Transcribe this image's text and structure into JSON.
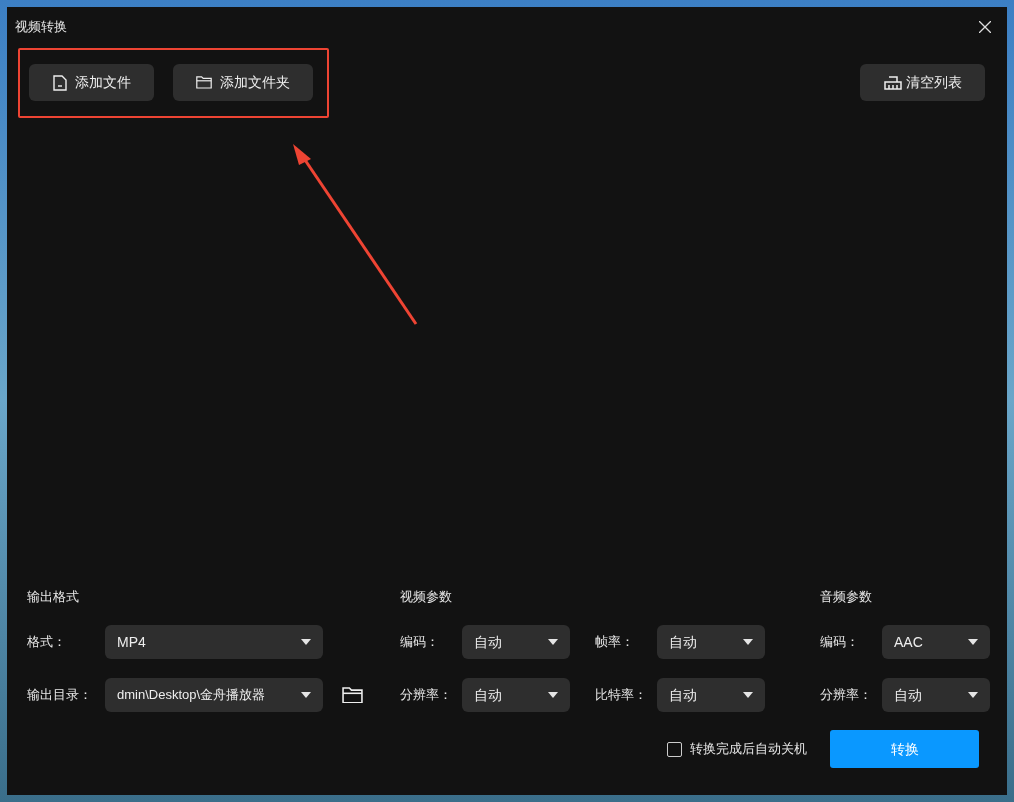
{
  "window": {
    "title": "视频转换"
  },
  "toolbar": {
    "buttons": [
      {
        "kind": "file",
        "label": "添加文件"
      },
      {
        "kind": "folder",
        "label": "添加文件夹"
      }
    ],
    "clear_button": "清空列表"
  },
  "output_format": {
    "heading": "输出格式",
    "format": {
      "label": "格式：",
      "value": "MP4"
    },
    "directory": {
      "label": "输出目录：",
      "value": "dmin\\Desktop\\金舟播放器"
    }
  },
  "video_params": {
    "heading": "视频参数",
    "fields": [
      {
        "label": "编码：",
        "value": "自动"
      },
      {
        "label": "帧率：",
        "value": "自动"
      },
      {
        "label": "分辨率：",
        "value": "自动"
      },
      {
        "label": "比特率：",
        "value": "自动"
      }
    ]
  },
  "audio_params": {
    "heading": "音频参数",
    "fields": [
      {
        "label": "编码：",
        "value": "AAC"
      },
      {
        "label": "分辨率：",
        "value": "自动"
      }
    ]
  },
  "auto_shutdown": {
    "label": "转换完成后自动关机",
    "checked": false
  },
  "convert_button": "转换"
}
